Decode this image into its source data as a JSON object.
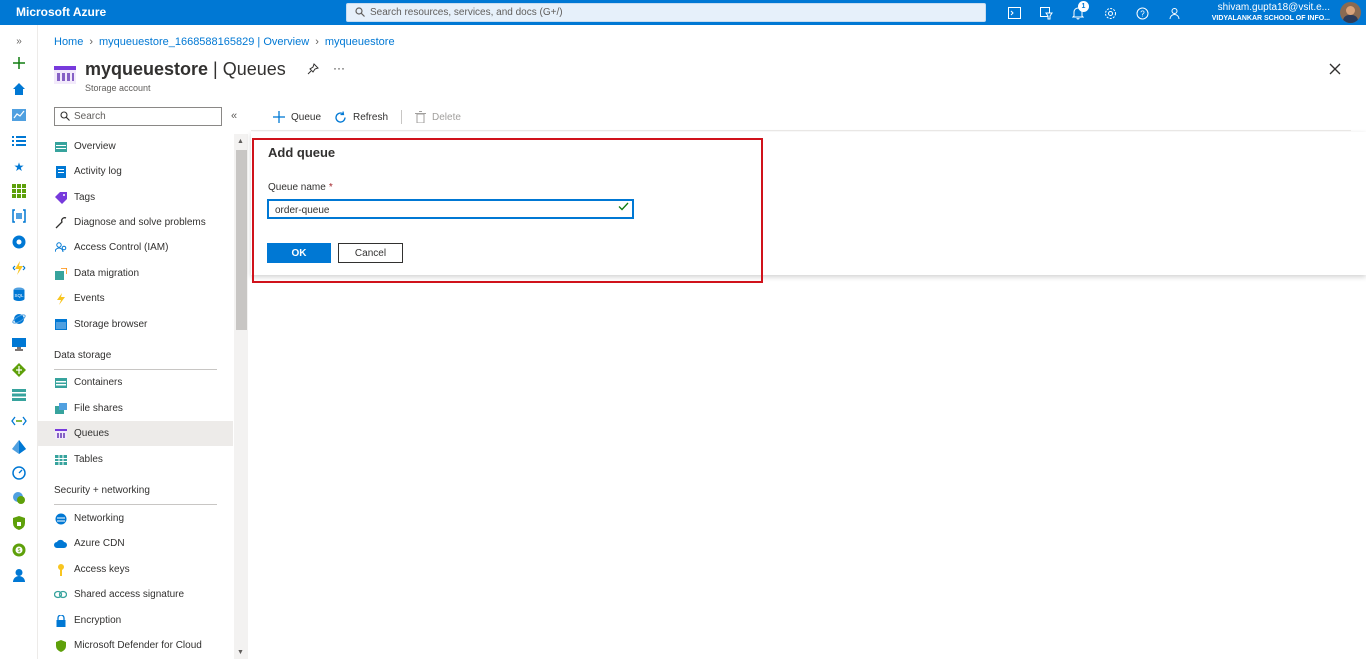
{
  "topbar": {
    "brand": "Microsoft Azure",
    "search_placeholder": "Search resources, services, and docs (G+/)",
    "notification_count": "1",
    "user_email": "shivam.gupta18@vsit.e...",
    "user_org": "VIDYALANKAR SCHOOL OF INFO...",
    "icons": [
      "cloud-shell-icon",
      "directory-filter-icon",
      "bell-icon",
      "gear-icon",
      "help-icon",
      "feedback-icon"
    ]
  },
  "rail": {
    "icons": [
      "expand-icon",
      "create-resource-icon",
      "home-icon",
      "dashboard-icon",
      "all-services-icon",
      "favorites-icon",
      "all-resources-icon",
      "resource-groups-icon",
      "app-services-icon",
      "function-app-icon",
      "sql-databases-icon",
      "cosmos-db-icon",
      "virtual-machines-icon",
      "load-balancer-icon",
      "storage-accounts-icon",
      "virtual-network-icon",
      "aad-icon",
      "monitor-icon",
      "advisor-icon",
      "defender-icon",
      "cost-management-icon",
      "help-support-icon"
    ]
  },
  "breadcrumb": [
    "Home",
    "myqueuestore_1668588165829 | Overview",
    "myqueuestore"
  ],
  "header": {
    "title_resource": "myqueuestore",
    "title_section": "Queues",
    "subtitle": "Storage account",
    "more": "···"
  },
  "nav": {
    "search_placeholder": "Search",
    "collapse": "«",
    "items_top": [
      {
        "label": "Overview",
        "icon": "overview-icon"
      },
      {
        "label": "Activity log",
        "icon": "activity-log-icon"
      },
      {
        "label": "Tags",
        "icon": "tag-icon"
      },
      {
        "label": "Diagnose and solve problems",
        "icon": "wrench-icon"
      },
      {
        "label": "Access Control (IAM)",
        "icon": "iam-icon"
      },
      {
        "label": "Data migration",
        "icon": "data-migration-icon"
      },
      {
        "label": "Events",
        "icon": "lightning-icon"
      },
      {
        "label": "Storage browser",
        "icon": "storage-browser-icon"
      }
    ],
    "section_data_storage": "Data storage",
    "items_data": [
      {
        "label": "Containers",
        "icon": "containers-icon"
      },
      {
        "label": "File shares",
        "icon": "file-shares-icon"
      },
      {
        "label": "Queues",
        "icon": "queues-icon",
        "selected": true
      },
      {
        "label": "Tables",
        "icon": "tables-icon"
      }
    ],
    "section_security": "Security + networking",
    "items_security": [
      {
        "label": "Networking",
        "icon": "networking-icon"
      },
      {
        "label": "Azure CDN",
        "icon": "cdn-icon"
      },
      {
        "label": "Access keys",
        "icon": "key-icon"
      },
      {
        "label": "Shared access signature",
        "icon": "link-icon"
      },
      {
        "label": "Encryption",
        "icon": "lock-icon"
      },
      {
        "label": "Microsoft Defender for Cloud",
        "icon": "defender-shield-icon"
      }
    ]
  },
  "toolbar": {
    "add_queue": "Queue",
    "refresh": "Refresh",
    "delete": "Delete"
  },
  "add_queue_panel": {
    "title": "Add queue",
    "field_label": "Queue name",
    "required_mark": "*",
    "field_value": "order-queue",
    "ok": "OK",
    "cancel": "Cancel"
  },
  "colors": {
    "azure_blue": "#0078d4",
    "highlight_red": "#d0121b"
  }
}
